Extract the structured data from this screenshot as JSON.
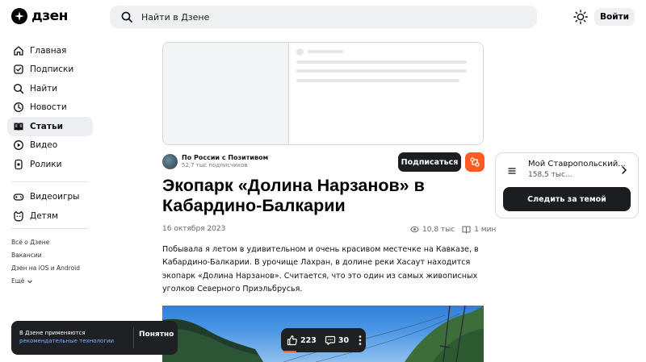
{
  "header": {
    "logo_text": "дзен",
    "search_placeholder": "Найти в Дзене",
    "login_label": "Войти"
  },
  "sidebar": {
    "items": [
      {
        "label": "Главная",
        "icon": "home-icon"
      },
      {
        "label": "Подписки",
        "icon": "subscriptions-icon"
      },
      {
        "label": "Найти",
        "icon": "search-icon"
      },
      {
        "label": "Новости",
        "icon": "news-icon"
      },
      {
        "label": "Статьи",
        "icon": "articles-icon",
        "active": true
      },
      {
        "label": "Видео",
        "icon": "video-icon"
      },
      {
        "label": "Ролики",
        "icon": "shorts-icon"
      },
      {
        "label": "Видеоигры",
        "icon": "gamepad-icon"
      },
      {
        "label": "Детям",
        "icon": "kids-icon"
      }
    ],
    "footer_links": [
      "Всё о Дзене",
      "Вакансии",
      "Дзен на iOS и Android",
      "Ещё"
    ]
  },
  "article": {
    "author_name": "По России с Позитивом",
    "author_subscribers": "52,7 тыс подписчиков",
    "subscribe_label": "Подписаться",
    "title": "Экопарк «Долина Нарзанов» в Кабардино-Балкарии",
    "date": "16 октября 2023",
    "views": "10,8 тыс",
    "read_time": "1 мин",
    "body": "Побывала я летом в удивительном и очень красивом местечке на Кавказе, в Кабардино-Балкарии. В урочище Лахран, в долине реки Хасаут находится экопарк «Долина Нарзанов». Считается, что это один из самых живописных уголков Северного Приэльбрусья."
  },
  "actions": {
    "likes": "223",
    "comments": "30"
  },
  "cookie_banner": {
    "text": "В Дзене применяются",
    "link_text": "рекомендательные технологии",
    "button_label": "Понятно"
  },
  "theme_card": {
    "name": "Мой Ставропольский...",
    "subscribers": "158,5 тыс...",
    "button_label": "Следить за темой"
  },
  "colors": {
    "accent": "#ff5a1f",
    "dark": "#1c1d20",
    "link": "#7fb2ff"
  }
}
